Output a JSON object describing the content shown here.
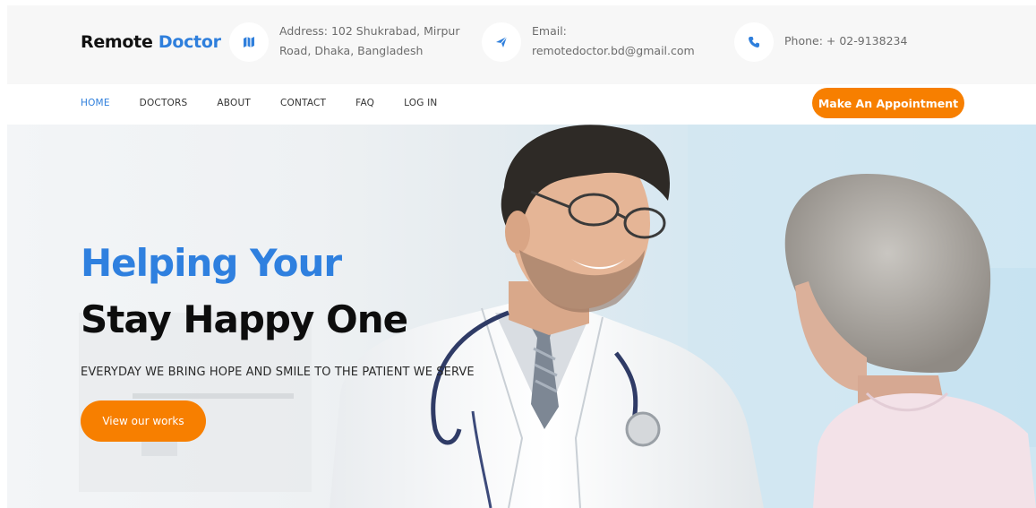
{
  "brand": {
    "name_part1": "Remote ",
    "name_part2": "Doctor"
  },
  "contact": {
    "address": {
      "icon": "map-icon",
      "line1": "Address: 102 Shukrabad, Mirpur",
      "line2": "Road, Dhaka, Bangladesh"
    },
    "email": {
      "icon": "paper-plane-icon",
      "line1": "Email:",
      "line2": "remotedoctor.bd@gmail.com"
    },
    "phone": {
      "icon": "phone-icon",
      "text": "Phone: + 02-9138234"
    }
  },
  "nav": {
    "items": [
      {
        "label": "HOME",
        "active": true
      },
      {
        "label": "DOCTORS"
      },
      {
        "label": "ABOUT"
      },
      {
        "label": "CONTACT"
      },
      {
        "label": "FAQ"
      },
      {
        "label": "LOG IN"
      }
    ],
    "appointment_label": "Make An Appointment"
  },
  "hero": {
    "title_line1": "Helping Your",
    "title_line2": "Stay Happy One",
    "subtitle": "EVERYDAY WE BRING HOPE AND SMILE TO THE PATIENT WE SERVE",
    "button_label": "View our works"
  },
  "colors": {
    "brand_blue": "#2f7fdc",
    "accent_orange": "#f77f00",
    "topbar_bg": "#f7f7f7",
    "text_dark": "#111111"
  }
}
